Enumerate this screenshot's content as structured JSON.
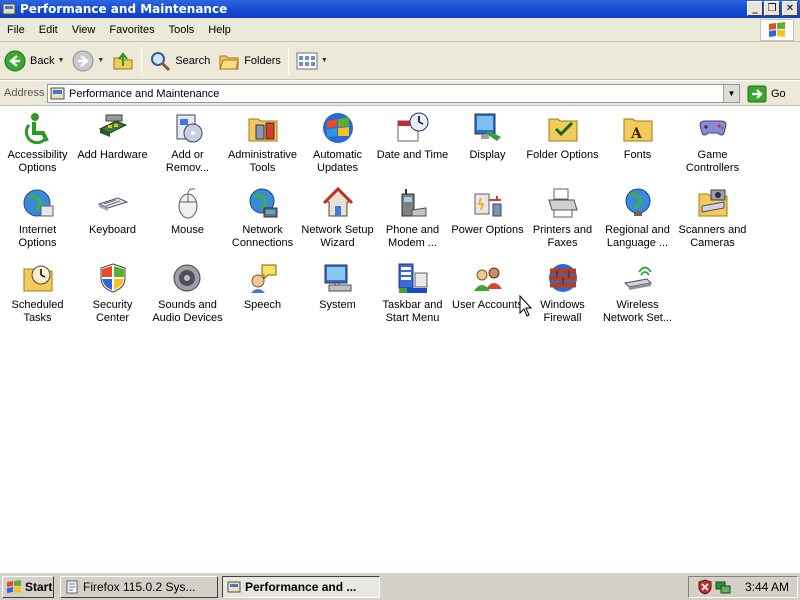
{
  "window": {
    "title": "Performance and Maintenance"
  },
  "menu": [
    "File",
    "Edit",
    "View",
    "Favorites",
    "Tools",
    "Help"
  ],
  "toolbar": {
    "back_label": "Back",
    "search_label": "Search",
    "folders_label": "Folders"
  },
  "address": {
    "label": "Address",
    "value": "Performance and Maintenance",
    "go_label": "Go"
  },
  "items": [
    {
      "label": "Accessibility\nOptions",
      "icon": "accessibility-icon"
    },
    {
      "label": "Add Hardware",
      "icon": "add-hardware-icon"
    },
    {
      "label": "Add or\nRemov...",
      "icon": "add-remove-programs-icon"
    },
    {
      "label": "Administrative\nTools",
      "icon": "administrative-tools-icon"
    },
    {
      "label": "Automatic\nUpdates",
      "icon": "automatic-updates-icon"
    },
    {
      "label": "Date and Time",
      "icon": "date-time-icon"
    },
    {
      "label": "Display",
      "icon": "display-icon"
    },
    {
      "label": "Folder Options",
      "icon": "folder-options-icon"
    },
    {
      "label": "Fonts",
      "icon": "fonts-icon"
    },
    {
      "label": "Game\nControllers",
      "icon": "game-controllers-icon"
    },
    {
      "label": "Internet\nOptions",
      "icon": "internet-options-icon"
    },
    {
      "label": "Keyboard",
      "icon": "keyboard-icon"
    },
    {
      "label": "Mouse",
      "icon": "mouse-icon"
    },
    {
      "label": "Network\nConnections",
      "icon": "network-connections-icon"
    },
    {
      "label": "Network Setup\nWizard",
      "icon": "network-setup-icon"
    },
    {
      "label": "Phone and\nModem ...",
      "icon": "phone-modem-icon"
    },
    {
      "label": "Power Options",
      "icon": "power-options-icon"
    },
    {
      "label": "Printers and\nFaxes",
      "icon": "printers-faxes-icon"
    },
    {
      "label": "Regional and\nLanguage ...",
      "icon": "regional-language-icon"
    },
    {
      "label": "Scanners and\nCameras",
      "icon": "scanners-cameras-icon"
    },
    {
      "label": "Scheduled\nTasks",
      "icon": "scheduled-tasks-icon"
    },
    {
      "label": "Security\nCenter",
      "icon": "security-center-icon"
    },
    {
      "label": "Sounds and\nAudio Devices",
      "icon": "sounds-audio-icon"
    },
    {
      "label": "Speech",
      "icon": "speech-icon"
    },
    {
      "label": "System",
      "icon": "system-icon"
    },
    {
      "label": "Taskbar and\nStart Menu",
      "icon": "taskbar-start-menu-icon"
    },
    {
      "label": "User Accounts",
      "icon": "user-accounts-icon"
    },
    {
      "label": "Windows\nFirewall",
      "icon": "windows-firewall-icon"
    },
    {
      "label": "Wireless\nNetwork Set...",
      "icon": "wireless-network-icon"
    }
  ],
  "taskbar": {
    "start_label": "Start",
    "tasks": [
      {
        "label": "Firefox 115.0.2 Sys...",
        "active": false
      },
      {
        "label": "Performance and ...",
        "active": true
      }
    ],
    "clock": "3:44 AM"
  }
}
